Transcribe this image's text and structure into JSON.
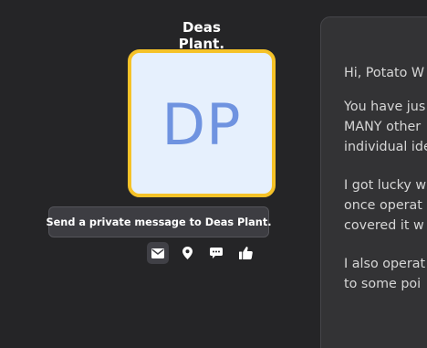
{
  "profile": {
    "name": "Deas Plant.",
    "initials": "DP",
    "tooltip": "Send a private message to Deas Plant."
  },
  "actions": [
    {
      "icon": "envelope-icon",
      "label": "private-message"
    },
    {
      "icon": "location-pin-icon",
      "label": "location"
    },
    {
      "icon": "speech-bubble-icon",
      "label": "comment"
    },
    {
      "icon": "thumbs-up-icon",
      "label": "like"
    }
  ],
  "message": {
    "greeting": "Hi, Potato W",
    "paragraphs": [
      [
        "You have jus",
        "MANY other",
        "individual ide"
      ],
      [
        "I got lucky w",
        "once operat",
        "covered it w"
      ],
      [
        "I also operat",
        "to some poi"
      ]
    ]
  },
  "colors": {
    "background": "#252527",
    "avatar_border": "#f5c228",
    "avatar_fill": "#e6f0fd",
    "initials": "#6f93e0",
    "panel": "#333335"
  }
}
